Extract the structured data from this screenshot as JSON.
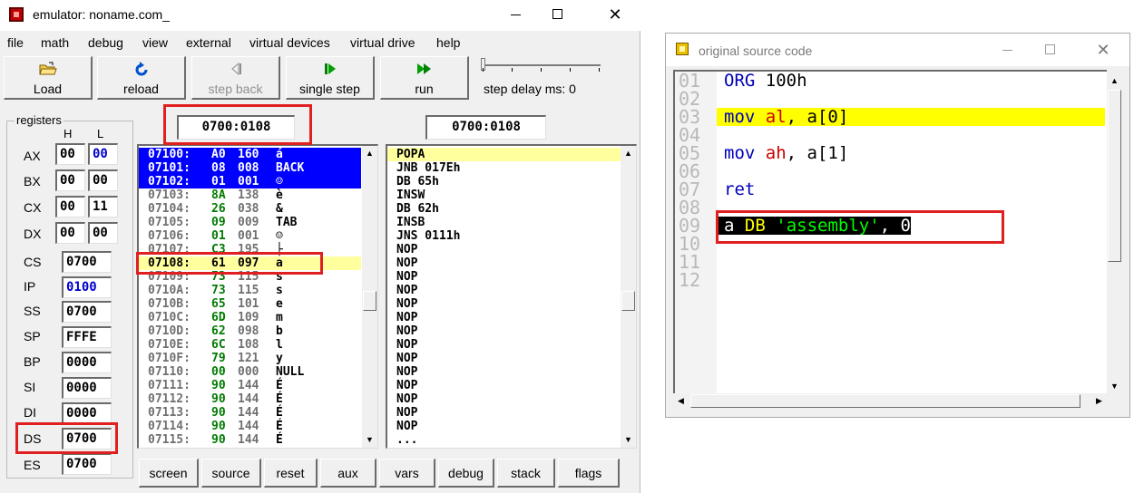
{
  "emulator": {
    "title": "emulator: noname.com_",
    "menu": [
      "file",
      "math",
      "debug",
      "view",
      "external",
      "virtual devices",
      "virtual drive",
      "help"
    ],
    "toolbar": {
      "load": "Load",
      "reload": "reload",
      "step_back": "step back",
      "single_step": "single step",
      "run": "run",
      "step_delay": "step delay ms: 0"
    },
    "registers": {
      "title": "registers",
      "h_label": "H",
      "l_label": "L",
      "pairs": [
        {
          "name": "AX",
          "h": "00",
          "l": "00"
        },
        {
          "name": "BX",
          "h": "00",
          "l": "00"
        },
        {
          "name": "CX",
          "h": "00",
          "l": "11"
        },
        {
          "name": "DX",
          "h": "00",
          "l": "00"
        }
      ],
      "singles": [
        {
          "name": "CS",
          "value": "0700"
        },
        {
          "name": "IP",
          "value": "0100"
        },
        {
          "name": "SS",
          "value": "0700"
        },
        {
          "name": "SP",
          "value": "FFFE"
        },
        {
          "name": "BP",
          "value": "0000"
        },
        {
          "name": "SI",
          "value": "0000"
        },
        {
          "name": "DI",
          "value": "0000"
        },
        {
          "name": "DS",
          "value": "0700"
        },
        {
          "name": "ES",
          "value": "0700"
        }
      ]
    },
    "memory_address": "0700:0108",
    "disasm_address": "0700:0108",
    "memory_rows": [
      {
        "addr": "07100:",
        "hex": "A0",
        "dec": "160",
        "chr": "á"
      },
      {
        "addr": "07101:",
        "hex": "08",
        "dec": "008",
        "chr": "BACK"
      },
      {
        "addr": "07102:",
        "hex": "01",
        "dec": "001",
        "chr": "☺"
      },
      {
        "addr": "07103:",
        "hex": "8A",
        "dec": "138",
        "chr": "è"
      },
      {
        "addr": "07104:",
        "hex": "26",
        "dec": "038",
        "chr": "&"
      },
      {
        "addr": "07105:",
        "hex": "09",
        "dec": "009",
        "chr": "TAB"
      },
      {
        "addr": "07106:",
        "hex": "01",
        "dec": "001",
        "chr": "☺"
      },
      {
        "addr": "07107:",
        "hex": "C3",
        "dec": "195",
        "chr": "├"
      },
      {
        "addr": "07108:",
        "hex": "61",
        "dec": "097",
        "chr": "a"
      },
      {
        "addr": "07109:",
        "hex": "73",
        "dec": "115",
        "chr": "s"
      },
      {
        "addr": "0710A:",
        "hex": "73",
        "dec": "115",
        "chr": "s"
      },
      {
        "addr": "0710B:",
        "hex": "65",
        "dec": "101",
        "chr": "e"
      },
      {
        "addr": "0710C:",
        "hex": "6D",
        "dec": "109",
        "chr": "m"
      },
      {
        "addr": "0710D:",
        "hex": "62",
        "dec": "098",
        "chr": "b"
      },
      {
        "addr": "0710E:",
        "hex": "6C",
        "dec": "108",
        "chr": "l"
      },
      {
        "addr": "0710F:",
        "hex": "79",
        "dec": "121",
        "chr": "y"
      },
      {
        "addr": "07110:",
        "hex": "00",
        "dec": "000",
        "chr": "NULL"
      },
      {
        "addr": "07111:",
        "hex": "90",
        "dec": "144",
        "chr": "É"
      },
      {
        "addr": "07112:",
        "hex": "90",
        "dec": "144",
        "chr": "É"
      },
      {
        "addr": "07113:",
        "hex": "90",
        "dec": "144",
        "chr": "É"
      },
      {
        "addr": "07114:",
        "hex": "90",
        "dec": "144",
        "chr": "É"
      },
      {
        "addr": "07115:",
        "hex": "90",
        "dec": "144",
        "chr": "É"
      }
    ],
    "disasm_rows": [
      "POPA",
      "JNB 017Eh",
      "DB 65h",
      "INSW",
      "DB 62h",
      "INSB",
      "JNS 0111h",
      "NOP",
      "NOP",
      "NOP",
      "NOP",
      "NOP",
      "NOP",
      "NOP",
      "NOP",
      "NOP",
      "NOP",
      "NOP",
      "NOP",
      "NOP",
      "NOP",
      "..."
    ],
    "bottom_buttons": [
      "screen",
      "source",
      "reset",
      "aux",
      "vars",
      "debug",
      "stack",
      "flags"
    ]
  },
  "source_window": {
    "title": "original source code",
    "line_numbers": [
      "01",
      "02",
      "03",
      "04",
      "05",
      "06",
      "07",
      "08",
      "09",
      "10",
      "11",
      "12"
    ],
    "code": {
      "l1": {
        "kw": "ORG",
        "rest": " 100h"
      },
      "l3": {
        "kw": "mov",
        "reg": "al",
        "rest": ", a[0]"
      },
      "l5": {
        "kw": "mov",
        "reg": "ah",
        "rest": ", a[1]"
      },
      "l7": {
        "kw": "ret"
      },
      "l9": {
        "label": "a",
        "kw": "DB",
        "str": "'assembly'",
        "rest": ", 0"
      }
    }
  },
  "colors": {
    "selection_blue": "#0000ff",
    "current_line_yellow": "#ffff9e",
    "source_highlight": "#ffff00",
    "annotation_red": "#e02020",
    "hex_green": "#007a00"
  }
}
